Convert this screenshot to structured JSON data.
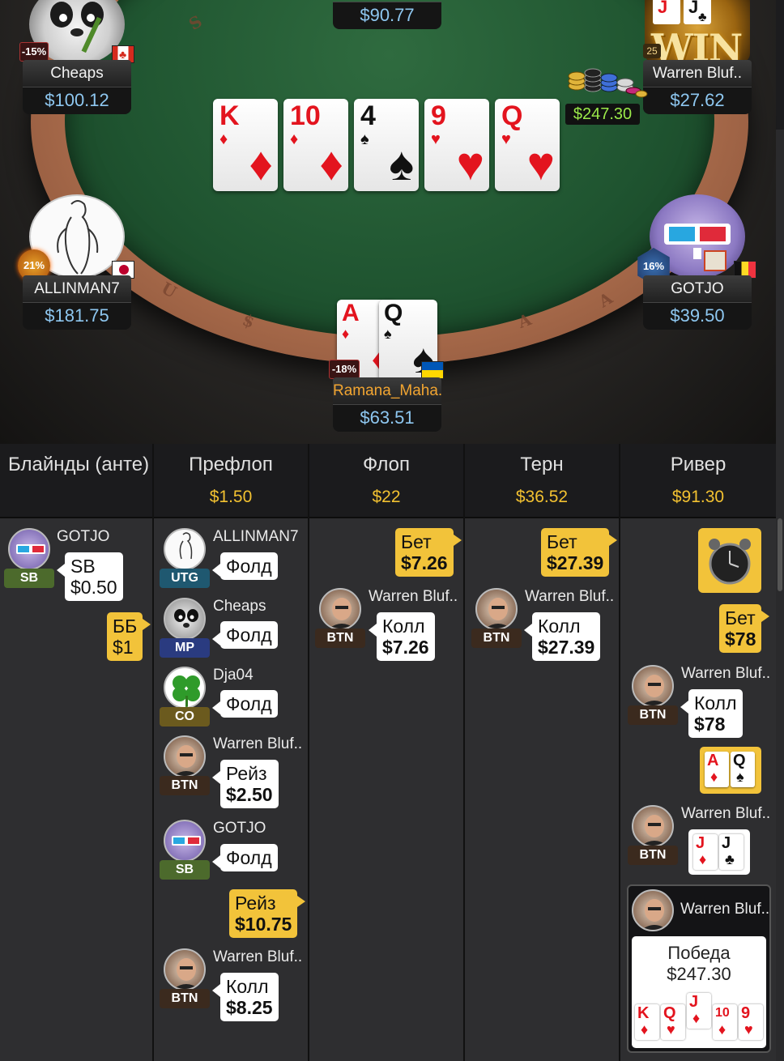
{
  "table": {
    "top_stack": "$90.77",
    "pot": "$247.30",
    "rail_letters": [
      "S",
      "U",
      "$",
      "A",
      "A"
    ],
    "board": [
      {
        "rank": "K",
        "suit": "♦",
        "color": "red"
      },
      {
        "rank": "10",
        "suit": "♦",
        "color": "red"
      },
      {
        "rank": "4",
        "suit": "♠",
        "color": "blk"
      },
      {
        "rank": "9",
        "suit": "♥",
        "color": "red"
      },
      {
        "rank": "Q",
        "suit": "♥",
        "color": "red"
      }
    ],
    "hero_cards": [
      {
        "rank": "A",
        "suit": "♦",
        "color": "red"
      },
      {
        "rank": "Q",
        "suit": "♠",
        "color": "blk"
      }
    ],
    "win_badge": "WIN",
    "win_level": "25",
    "seats": {
      "cheaps": {
        "name": "Cheaps",
        "stack": "$100.12",
        "pct": "-15%",
        "flag": "canada"
      },
      "warren": {
        "name": "Warren Bluf..",
        "stack": "$27.62"
      },
      "allinman": {
        "name": "ALLINMAN7",
        "stack": "$181.75",
        "pct": "21%",
        "flag": "japan"
      },
      "gotjo": {
        "name": "GOTJO",
        "stack": "$39.50",
        "pct": "16%",
        "flag": "belgium"
      },
      "ramana": {
        "name": "Ramana_Maha..",
        "stack": "$63.51",
        "pct": "-18%",
        "flag": "ukraine"
      }
    }
  },
  "streets": [
    {
      "title": "Блайнды (анте)",
      "pot": ""
    },
    {
      "title": "Префлоп",
      "pot": "$1.50"
    },
    {
      "title": "Флоп",
      "pot": "$22"
    },
    {
      "title": "Терн",
      "pot": "$36.52"
    },
    {
      "title": "Ривер",
      "pot": "$91.30"
    }
  ],
  "blinds": {
    "gotjo_name": "GOTJO",
    "gotjo_pos": "SB",
    "gotjo_action": "SB",
    "gotjo_amount": "$0.50",
    "bb_label": "ББ",
    "bb_amount": "$1"
  },
  "preflop": [
    {
      "name": "ALLINMAN7",
      "pos": "UTG",
      "action": "Фолд"
    },
    {
      "name": "Cheaps",
      "pos": "MP",
      "action": "Фолд"
    },
    {
      "name": "Dja04",
      "pos": "CO",
      "action": "Фолд"
    },
    {
      "name": "Warren Bluf..",
      "pos": "BTN",
      "action": "Рейз",
      "amount": "$2.50"
    },
    {
      "name": "GOTJO",
      "pos": "SB",
      "action": "Фолд"
    },
    {
      "hero_action": "Рейз",
      "hero_amount": "$10.75"
    },
    {
      "name": "Warren Bluf..",
      "pos": "BTN",
      "action": "Колл",
      "amount": "$8.25"
    }
  ],
  "flop": {
    "hero_action": "Бет",
    "hero_amount": "$7.26",
    "opp_name": "Warren Bluf..",
    "opp_pos": "BTN",
    "opp_action": "Колл",
    "opp_amount": "$7.26"
  },
  "turn": {
    "hero_action": "Бет",
    "hero_amount": "$27.39",
    "opp_name": "Warren Bluf..",
    "opp_pos": "BTN",
    "opp_action": "Колл",
    "opp_amount": "$27.39"
  },
  "river": {
    "hero_action": "Бет",
    "hero_amount": "$78",
    "opp_name": "Warren Bluf..",
    "opp_pos": "BTN",
    "opp_action": "Колл",
    "opp_amount": "$78",
    "hero_show": [
      {
        "rank": "A",
        "suit": "♦",
        "color": "red"
      },
      {
        "rank": "Q",
        "suit": "♠",
        "color": "blk"
      }
    ],
    "opp_show_name": "Warren Bluf..",
    "opp_show_pos": "BTN",
    "opp_show": [
      {
        "rank": "J",
        "suit": "♦",
        "color": "red"
      },
      {
        "rank": "J",
        "suit": "♣",
        "color": "blk"
      }
    ],
    "winner_name": "Warren Bluf..",
    "win_label": "Победа",
    "win_amount": "$247.30",
    "win_cards": [
      {
        "rank": "K",
        "suit": "♦",
        "color": "red"
      },
      {
        "rank": "Q",
        "suit": "♥",
        "color": "red"
      },
      {
        "rank": "J",
        "suit": "♦",
        "color": "red"
      },
      {
        "rank": "10",
        "suit": "♦",
        "color": "red"
      },
      {
        "rank": "9",
        "suit": "♥",
        "color": "red"
      }
    ]
  },
  "colors": {
    "accent_gold": "#f2c131",
    "stack_blue": "#8ec7f0",
    "felt": "#1f5430"
  }
}
